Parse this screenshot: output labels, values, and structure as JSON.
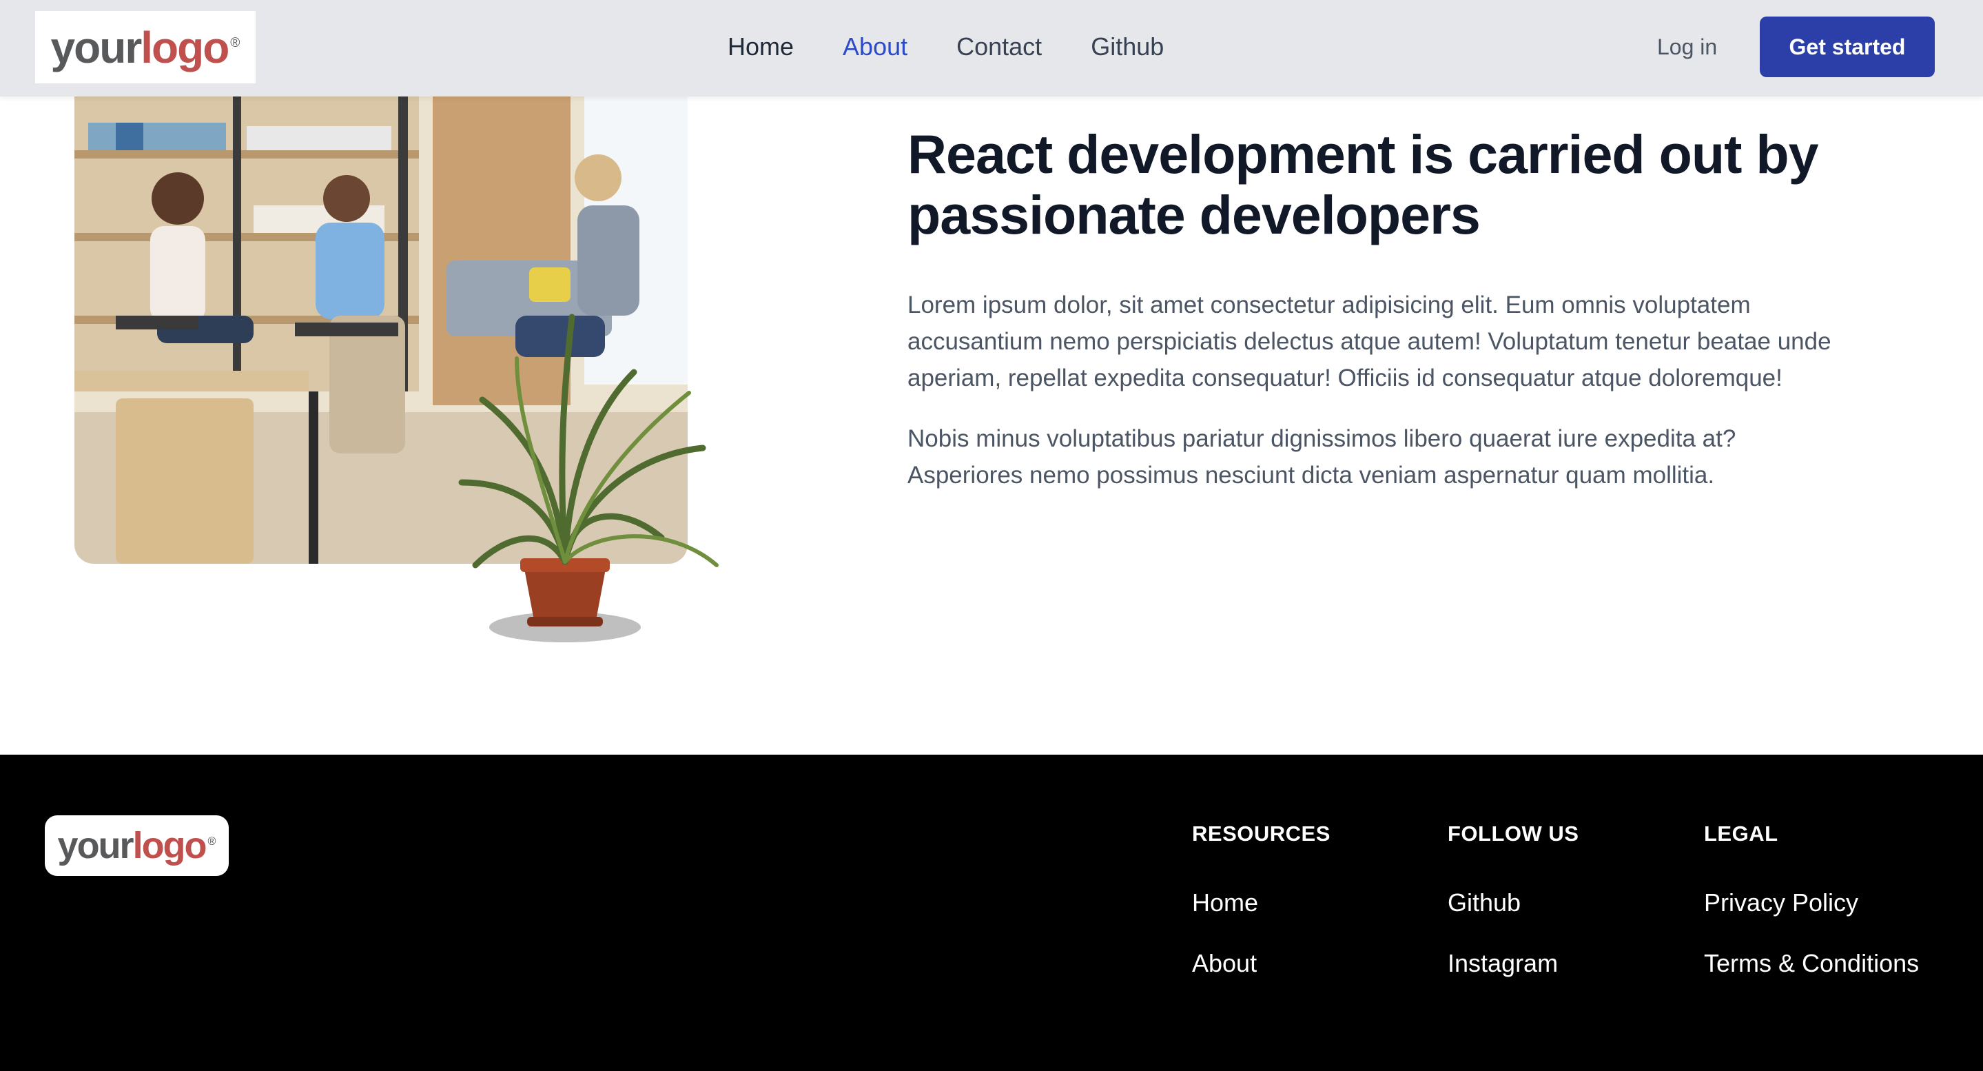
{
  "header": {
    "logo": {
      "your": "your",
      "logo": "logo",
      "reg": "®"
    },
    "nav": [
      {
        "label": "Home",
        "active": false
      },
      {
        "label": "About",
        "active": true
      },
      {
        "label": "Contact",
        "active": false
      },
      {
        "label": "Github",
        "active": false
      }
    ],
    "login_label": "Log in",
    "cta_label": "Get started"
  },
  "main": {
    "headline": "React development is carried out by passionate developers",
    "paragraphs": [
      "Lorem ipsum dolor, sit amet consectetur adipisicing elit. Eum omnis voluptatem accusantium nemo perspiciatis delectus atque autem! Voluptatum tenetur beatae unde aperiam, repellat expedita consequatur! Officiis id consequatur atque doloremque!",
      "Nobis minus voluptatibus pariatur dignissimos libero quaerat iure expedita at? Asperiores nemo possimus nesciunt dicta veniam aspernatur quam mollitia."
    ]
  },
  "footer": {
    "logo": {
      "your": "your",
      "logo": "logo",
      "reg": "®"
    },
    "columns": [
      {
        "heading": "RESOURCES",
        "links": [
          "Home",
          "About"
        ]
      },
      {
        "heading": "FOLLOW US",
        "links": [
          "Github",
          "Instagram"
        ]
      },
      {
        "heading": "LEGAL",
        "links": [
          "Privacy Policy",
          "Terms & Conditions"
        ]
      }
    ]
  },
  "colors": {
    "header_bg": "#e5e7eb",
    "accent": "#2b4bc9",
    "cta_bg": "#2c3fa8",
    "footer_bg": "#000000",
    "logo_red": "#c0504d"
  },
  "icons": [
    "brand-logo",
    "office-photo",
    "potted-plant"
  ]
}
